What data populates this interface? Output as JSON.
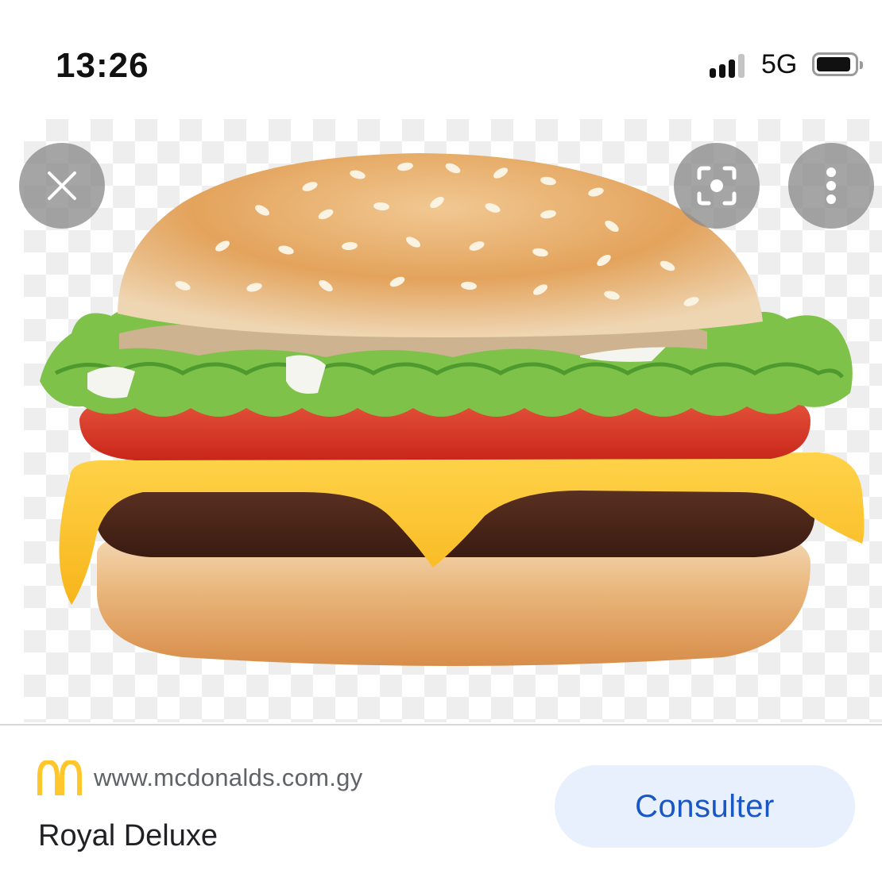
{
  "status_bar": {
    "time": "13:26",
    "network": "5G",
    "signal_bars": 3,
    "signal_bars_total": 4,
    "battery_icon": "battery-icon"
  },
  "viewer": {
    "image_subject": "burger-image",
    "buttons": {
      "close_icon": "close-icon",
      "lens_icon": "lens-search-icon",
      "more_icon": "more-vertical-icon"
    }
  },
  "result": {
    "site_logo": "mcdonalds-logo",
    "site_url": "www.mcdonalds.com.gy",
    "title": "Royal Deluxe",
    "action_label": "Consulter"
  },
  "colors": {
    "accent": "#1a57c4",
    "button_bg": "#e8f0fe",
    "logo_yellow": "#ffc72c"
  }
}
